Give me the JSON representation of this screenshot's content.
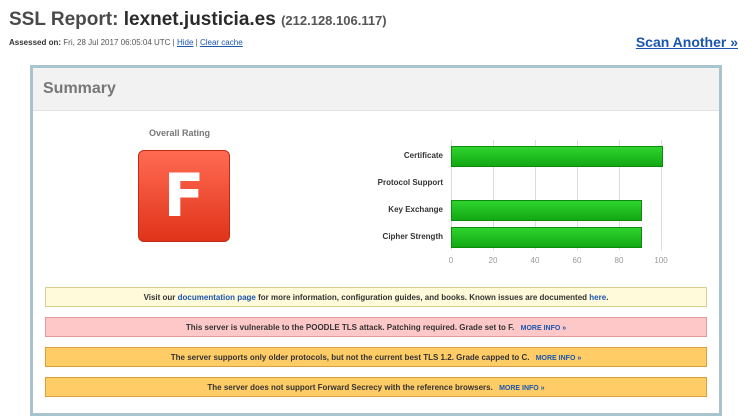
{
  "header": {
    "title_prefix": "SSL Report:",
    "host": "lexnet.justicia.es",
    "ip": "(212.128.106.117)",
    "assessed_label": "Assessed on:",
    "assessed_value": "Fri, 28 Jul 2017 06:05:04 UTC |",
    "hide_link": "Hide",
    "separator": "|",
    "clear_cache_link": "Clear cache",
    "scan_another": "Scan Another »"
  },
  "summary": {
    "title": "Summary",
    "overall_rating_label": "Overall Rating",
    "grade": "F",
    "grade_color": "#e8452c"
  },
  "chart_data": {
    "type": "bar",
    "orientation": "horizontal",
    "categories": [
      "Certificate",
      "Protocol Support",
      "Key Exchange",
      "Cipher Strength"
    ],
    "values": [
      100,
      0,
      90,
      90
    ],
    "xlim": [
      0,
      100
    ],
    "ticks": [
      "0",
      "20",
      "40",
      "60",
      "80",
      "100"
    ],
    "bar_color": "#1ec41e",
    "grid": true
  },
  "notices": {
    "info_pre": "Visit our",
    "info_link": "documentation page",
    "info_mid": "for more information, configuration guides, and books. Known issues are documented",
    "info_link2": "here",
    "info_end": ".",
    "poodle": "This server is vulnerable to the POODLE TLS attack. Patching required. Grade set to F.",
    "poodle_more": "MORE INFO »",
    "tls12": "The server supports only older protocols, but not the current best TLS 1.2. Grade capped to C.",
    "tls12_more": "MORE INFO »",
    "fs": "The server does not support Forward Secrecy with the reference browsers.",
    "fs_more": "MORE INFO »"
  }
}
